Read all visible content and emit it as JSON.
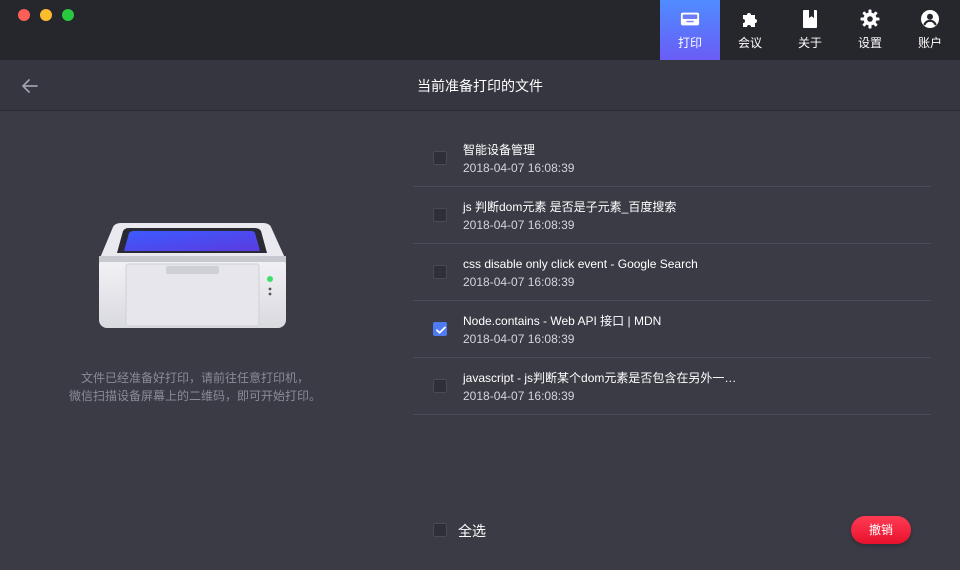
{
  "nav": {
    "items": [
      {
        "label": "打印",
        "icon": "printer-icon",
        "active": true
      },
      {
        "label": "会议",
        "icon": "puzzle-icon",
        "active": false
      },
      {
        "label": "关于",
        "icon": "book-icon",
        "active": false
      },
      {
        "label": "设置",
        "icon": "gear-icon",
        "active": false
      },
      {
        "label": "账户",
        "icon": "user-icon",
        "active": false
      }
    ]
  },
  "header": {
    "title": "当前准备打印的文件"
  },
  "hint": {
    "line1": "文件已经准备好打印，请前往任意打印机，",
    "line2": "微信扫描设备屏幕上的二维码，即可开始打印。"
  },
  "files": [
    {
      "title": "智能设备管理",
      "date": "2018-04-07 16:08:39",
      "checked": false
    },
    {
      "title": "js 判断dom元素 是否是子元素_百度搜索",
      "date": "2018-04-07 16:08:39",
      "checked": false
    },
    {
      "title": "css disable only click event - Google Search",
      "date": "2018-04-07 16:08:39",
      "checked": false
    },
    {
      "title": "Node.contains - Web API 接口 | MDN",
      "date": "2018-04-07 16:08:39",
      "checked": true
    },
    {
      "title": "javascript - js判断某个dom元素是否包含在另外一…",
      "date": "2018-04-07 16:08:39",
      "checked": false
    }
  ],
  "footer": {
    "select_all_label": "全选",
    "cancel_label": "撤销"
  },
  "colors": {
    "accent": "#4f7bf2",
    "danger": "#e8112d",
    "nav_active_top": "#4f8cff",
    "nav_active_bottom": "#6a5cf6"
  }
}
